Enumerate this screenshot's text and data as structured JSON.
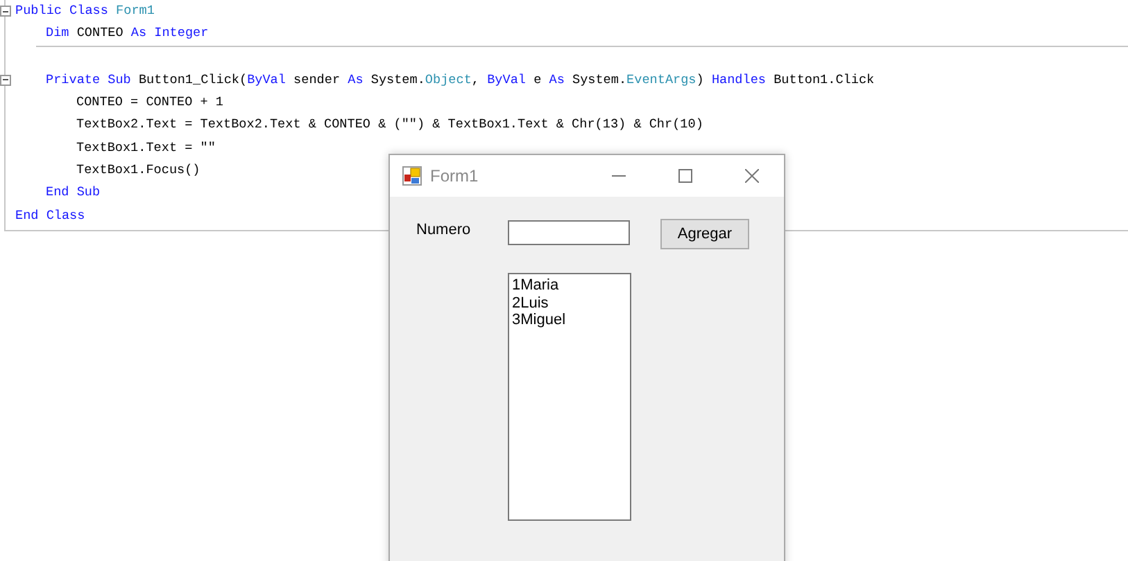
{
  "editor": {
    "lines": [
      {
        "kind": "code",
        "tokens": [
          {
            "kind": "keyword",
            "text": "Public Class "
          },
          {
            "kind": "type",
            "text": "Form1"
          }
        ],
        "children": [
          {
            "kind": "code",
            "tokens": [
              {
                "kind": "keyword",
                "text": "Dim "
              },
              {
                "kind": "plain",
                "text": "CONTEO "
              },
              {
                "kind": "keyword",
                "text": "As Integer"
              }
            ]
          },
          {
            "kind": "separator"
          },
          {
            "kind": "code",
            "tokens": [
              {
                "kind": "keyword",
                "text": "Private Sub "
              },
              {
                "kind": "plain",
                "text": "Button1_Click("
              },
              {
                "kind": "keyword",
                "text": "ByVal "
              },
              {
                "kind": "plain",
                "text": "sender "
              },
              {
                "kind": "keyword",
                "text": "As "
              },
              {
                "kind": "plain",
                "text": "System."
              },
              {
                "kind": "type",
                "text": "Object"
              },
              {
                "kind": "plain",
                "text": ", "
              },
              {
                "kind": "keyword",
                "text": "ByVal "
              },
              {
                "kind": "plain",
                "text": "e "
              },
              {
                "kind": "keyword",
                "text": "As "
              },
              {
                "kind": "plain",
                "text": "System."
              },
              {
                "kind": "type",
                "text": "EventArgs"
              },
              {
                "kind": "plain",
                "text": ") "
              },
              {
                "kind": "keyword",
                "text": "Handles "
              },
              {
                "kind": "plain",
                "text": "Button1.Click"
              }
            ],
            "children": [
              {
                "kind": "code",
                "tokens": [
                  {
                    "kind": "plain",
                    "text": "CONTEO = CONTEO + 1"
                  }
                ]
              },
              {
                "kind": "code",
                "tokens": [
                  {
                    "kind": "plain",
                    "text": "TextBox2.Text = TextBox2.Text & CONTEO & (\"\") & TextBox1.Text & Chr(13) & Chr(10)"
                  }
                ]
              },
              {
                "kind": "code",
                "tokens": [
                  {
                    "kind": "plain",
                    "text": "TextBox1.Text = \"\""
                  }
                ]
              },
              {
                "kind": "code",
                "tokens": [
                  {
                    "kind": "plain",
                    "text": "TextBox1.Focus()"
                  }
                ]
              }
            ]
          },
          {
            "kind": "code",
            "tokens": [
              {
                "kind": "keyword",
                "text": "End Sub"
              }
            ]
          }
        ]
      },
      {
        "kind": "code",
        "tokens": [
          {
            "kind": "keyword",
            "text": "End Class"
          }
        ]
      }
    ]
  },
  "form": {
    "title": "Form1",
    "label": "Numero",
    "button": "Agregar",
    "list": [
      "1Maria",
      "2Luis",
      "3Miguel"
    ]
  }
}
